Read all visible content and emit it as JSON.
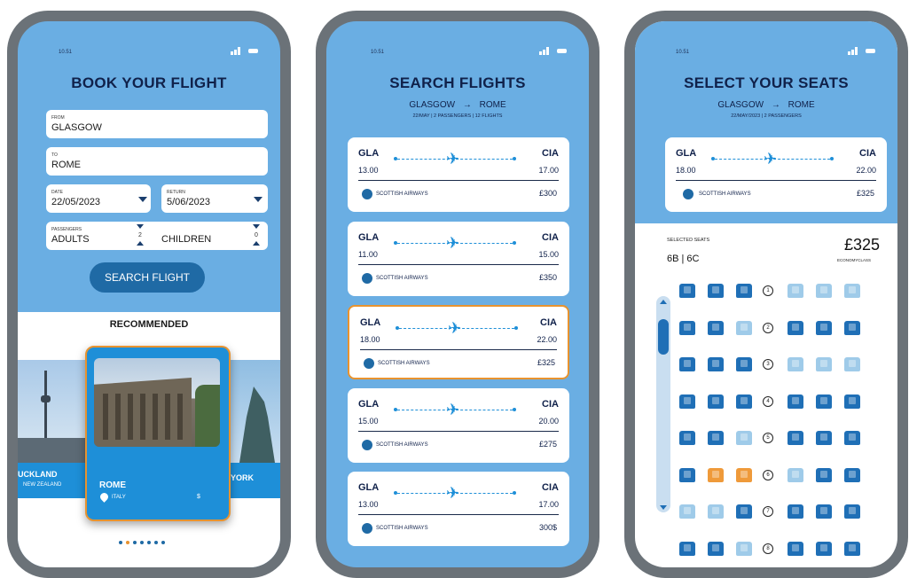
{
  "status": {
    "time": "10.51"
  },
  "book": {
    "title": "BOOK YOUR FLIGHT",
    "from_label": "FROM",
    "from_value": "GLASGOW",
    "to_label": "TO",
    "to_value": "ROME",
    "date_label": "DATE",
    "date_value": "22/05/2023",
    "return_label": "RETURN",
    "return_value": "5/06/2023",
    "passengers_label": "PASSENGERS",
    "adults_label": "ADULTS",
    "adults_count": "2",
    "children_label": "CHILDREN",
    "children_count": "0",
    "search_button": "SEARCH FLIGHT",
    "recommended": "RECOMMENDED",
    "destinations": [
      {
        "city": "UCKLAND",
        "country": "NEW ZEALAND"
      },
      {
        "city": "ROME",
        "country": "ITALY",
        "price": "$"
      },
      {
        "city": "YORK"
      }
    ]
  },
  "search": {
    "title": "SEARCH FLIGHTS",
    "route_from": "GLASGOW",
    "route_to": "ROME",
    "meta": "22/MAY | 2 PASSENGERS | 12 FLIGHTS",
    "flights": [
      {
        "from": "GLA",
        "to": "CIA",
        "dep": "13.00",
        "arr": "17.00",
        "airline": "SCOTTISH AIRWAYS",
        "price": "£300"
      },
      {
        "from": "GLA",
        "to": "CIA",
        "dep": "11.00",
        "arr": "15.00",
        "airline": "SCOTTISH AIRWAYS",
        "price": "£350"
      },
      {
        "from": "GLA",
        "to": "CIA",
        "dep": "18.00",
        "arr": "22.00",
        "airline": "SCOTTISH AIRWAYS",
        "price": "£325"
      },
      {
        "from": "GLA",
        "to": "CIA",
        "dep": "15.00",
        "arr": "20.00",
        "airline": "SCOTTISH AIRWAYS",
        "price": "£275"
      },
      {
        "from": "GLA",
        "to": "CIA",
        "dep": "13.00",
        "arr": "17.00",
        "airline": "SCOTTISH AIRWAYS",
        "price": "300$"
      }
    ]
  },
  "seats": {
    "title": "SELECT YOUR SEATS",
    "route_from": "GLASGOW",
    "route_to": "ROME",
    "meta": "22/MAY/2023 | 2 PASSENGERS",
    "flight": {
      "from": "GLA",
      "to": "CIA",
      "dep": "18.00",
      "arr": "22.00",
      "airline": "SCOTTISH AIRWAYS",
      "price": "£325"
    },
    "selected_label": "SELECTED SEATS",
    "selected_value": "6B | 6C",
    "total_price": "£325",
    "class_label": "ECONOMYCLASS",
    "rows": [
      "1",
      "2",
      "3",
      "4",
      "5",
      "6",
      "7",
      "8"
    ],
    "colors": {
      "available": "#1f6fb6",
      "taken": "#9fcbe9",
      "selected": "#ef9a3a"
    }
  }
}
